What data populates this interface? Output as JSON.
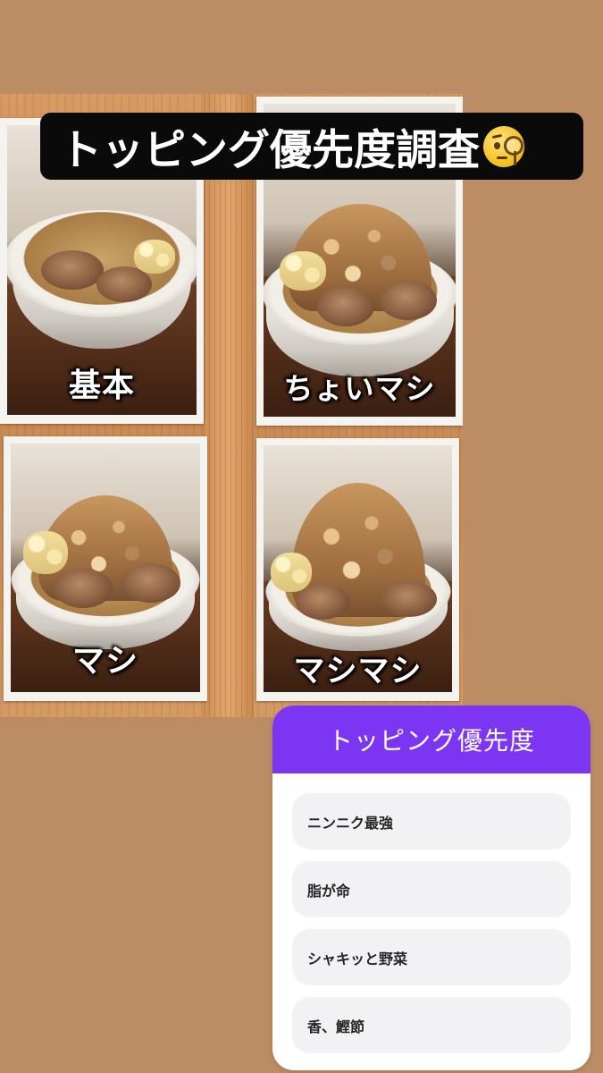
{
  "story": {
    "title": "トッピング優先度調査",
    "title_emoji": "face-with-monocle-icon"
  },
  "photo": {
    "cards": [
      {
        "label": "基本"
      },
      {
        "label": "ちょいマシ"
      },
      {
        "label": "マシ"
      },
      {
        "label": "マシマシ"
      }
    ]
  },
  "quiz": {
    "question": "トッピング優先度",
    "options": [
      "ニンニク最強",
      "脂が命",
      "シャキッと野菜",
      "香、鰹節"
    ]
  },
  "colors": {
    "background": "#bc8c64",
    "quiz_header": "#7c35f2",
    "option_bg": "#f2f2f4"
  }
}
